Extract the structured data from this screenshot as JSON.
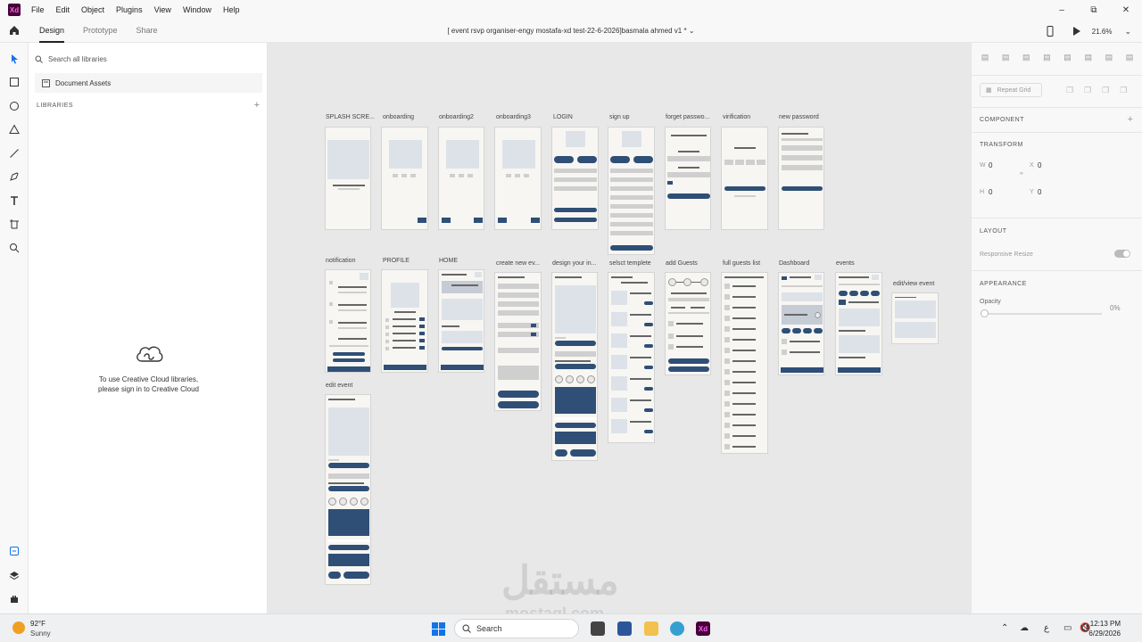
{
  "app": {
    "logo": "Xd",
    "brand_color": "#470137"
  },
  "menu": [
    "File",
    "Edit",
    "Object",
    "Plugins",
    "View",
    "Window",
    "Help"
  ],
  "window_controls": {
    "minimize": "–",
    "restore": "⧉",
    "close": "✕"
  },
  "header": {
    "tabs": [
      {
        "label": "Design",
        "active": true
      },
      {
        "label": "Prototype",
        "active": false
      },
      {
        "label": "Share",
        "active": false
      }
    ],
    "document_title": "[ event rsvp organiser-engy mostafa-xd test-22-6-2026]basmala ahmed v1 *",
    "zoom": "21.6%"
  },
  "library": {
    "search_placeholder": "Search all libraries",
    "document_assets": "Document Assets",
    "libraries_heading": "LIBRARIES",
    "signin_line1": "To use Creative Cloud libraries,",
    "signin_line2": "please sign in to Creative Cloud"
  },
  "artboards": [
    {
      "label": "SPLASH SCRE..."
    },
    {
      "label": "onboarding"
    },
    {
      "label": "onboarding2"
    },
    {
      "label": "onboarding3"
    },
    {
      "label": "LOGIN"
    },
    {
      "label": "sign up"
    },
    {
      "label": "forget passwo..."
    },
    {
      "label": "virification"
    },
    {
      "label": "new password"
    },
    {
      "label": "notification"
    },
    {
      "label": "PROFILE"
    },
    {
      "label": "HOME"
    },
    {
      "label": "create new ev..."
    },
    {
      "label": "design your in..."
    },
    {
      "label": "selsct templete"
    },
    {
      "label": "add Guests"
    },
    {
      "label": "full guests list"
    },
    {
      "label": "Dashboard"
    },
    {
      "label": "events"
    },
    {
      "label": "edit/view event"
    },
    {
      "label": "edit event"
    }
  ],
  "watermark": {
    "arabic": "مستقل",
    "latin": "mostaql.com"
  },
  "properties": {
    "repeat_grid": "Repeat Grid",
    "component": "COMPONENT",
    "transform": "TRANSFORM",
    "w_label": "W",
    "w_value": "0",
    "x_label": "X",
    "x_value": "0",
    "h_label": "H",
    "h_value": "0",
    "y_label": "Y",
    "y_value": "0",
    "layout": "LAYOUT",
    "responsive_resize": "Responsive Resize",
    "appearance": "APPEARANCE",
    "opacity_label": "Opacity",
    "opacity_value": "0%"
  },
  "taskbar": {
    "weather_temp": "92°F",
    "weather_condition": "Sunny",
    "search_label": "Search",
    "time": "12:13 PM",
    "date": "6/29/2026"
  },
  "colors": {
    "accent_navy": "#2f4f77",
    "canvas_bg": "#e8e8e8"
  }
}
